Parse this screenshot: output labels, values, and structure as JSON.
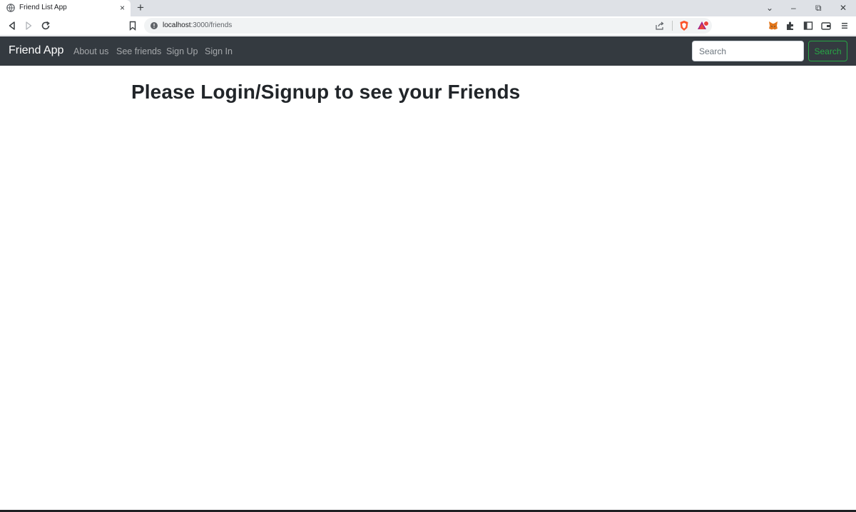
{
  "browser": {
    "tab_title": "Friend List App",
    "tab_close": "×",
    "new_tab": "+",
    "window_controls": {
      "list": "⌄",
      "minimize": "–",
      "restore": "⧉",
      "close": "✕"
    },
    "url_host": "localhost",
    "url_path": ":3000/friends",
    "icons": [
      "back-icon",
      "forward-icon",
      "reload-icon",
      "bookmark-icon",
      "site-info-icon",
      "share-icon",
      "brave-shield-icon",
      "brave-rewards-icon",
      "metamask-icon",
      "extensions-icon",
      "sidebar-icon",
      "wallet-icon",
      "menu-icon"
    ]
  },
  "navbar": {
    "brand": "Friend App",
    "links": [
      "About us",
      "See friends",
      "Sign Up",
      "Sign In"
    ],
    "search_placeholder": "Search",
    "search_button": "Search"
  },
  "main": {
    "heading": "Please Login/Signup to see your Friends"
  },
  "colors": {
    "navbar_bg": "#343a40",
    "success": "#28a745",
    "text": "#212529"
  }
}
